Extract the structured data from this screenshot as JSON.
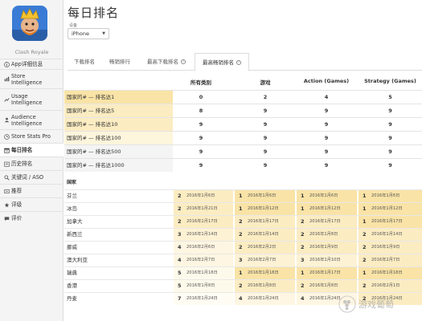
{
  "app": {
    "name": "Clash Royale"
  },
  "sidebar": {
    "items": [
      {
        "label": "App详细信息",
        "icon": "info-icon",
        "active": false
      },
      {
        "label": "Store\nIntelligence",
        "icon": "store-icon",
        "active": false
      },
      {
        "label": "Usage\nIntelligence",
        "icon": "usage-icon",
        "active": false
      },
      {
        "label": "Audience\nIntelligence",
        "icon": "audience-icon",
        "active": false
      },
      {
        "label": "Store Stats Pro",
        "icon": "stats-pro-icon",
        "active": false
      },
      {
        "label": "每日排名",
        "icon": "daily-rank-icon",
        "active": true
      },
      {
        "label": "历史排名",
        "icon": "history-rank-icon",
        "active": false
      },
      {
        "label": "关键词 / ASO",
        "icon": "keyword-icon",
        "active": false
      },
      {
        "label": "推荐",
        "icon": "recommend-icon",
        "active": false
      },
      {
        "label": "评级",
        "icon": "rating-icon",
        "active": false
      },
      {
        "label": "评价",
        "icon": "review-icon",
        "active": false
      }
    ]
  },
  "page": {
    "title": "每日排名"
  },
  "device": {
    "label": "设备",
    "value": "iPhone"
  },
  "tabs": [
    {
      "label": "下载排名",
      "help": false,
      "active": false
    },
    {
      "label": "畅销排行",
      "help": false,
      "active": false
    },
    {
      "label": "最高下载排名",
      "help": true,
      "active": false
    },
    {
      "label": "最高畅销排名",
      "help": true,
      "active": true
    }
  ],
  "summary": {
    "columns": [
      "所有类别",
      "游戏",
      "Action (Games)",
      "Strategy (Games)"
    ],
    "rows": [
      {
        "label": "国家的# — 排名达1",
        "values": [
          "0",
          "2",
          "4",
          "5"
        ]
      },
      {
        "label": "国家的# — 排名达5",
        "values": [
          "8",
          "9",
          "9",
          "9"
        ]
      },
      {
        "label": "国家的# — 排名达10",
        "values": [
          "9",
          "9",
          "9",
          "9"
        ]
      },
      {
        "label": "国家的# — 排名达100",
        "values": [
          "9",
          "9",
          "9",
          "9"
        ]
      },
      {
        "label": "国家的# — 排名达500",
        "values": [
          "9",
          "9",
          "9",
          "9"
        ]
      },
      {
        "label": "国家的# — 排名达1000",
        "values": [
          "9",
          "9",
          "9",
          "9"
        ]
      }
    ]
  },
  "countries": {
    "header": "国家",
    "rows": [
      {
        "name": "芬兰",
        "cells": [
          {
            "rank": "2",
            "date": "2016年1月6日"
          },
          {
            "rank": "1",
            "date": "2016年1月6日"
          },
          {
            "rank": "1",
            "date": "2016年1月6日"
          },
          {
            "rank": "1",
            "date": "2016年1月6日"
          }
        ]
      },
      {
        "name": "冰岛",
        "cells": [
          {
            "rank": "2",
            "date": "2016年1月21日"
          },
          {
            "rank": "1",
            "date": "2016年1月12日"
          },
          {
            "rank": "1",
            "date": "2016年1月12日"
          },
          {
            "rank": "1",
            "date": "2016年1月12日"
          }
        ]
      },
      {
        "name": "加拿大",
        "cells": [
          {
            "rank": "2",
            "date": "2016年1月17日"
          },
          {
            "rank": "2",
            "date": "2016年1月17日"
          },
          {
            "rank": "2",
            "date": "2016年1月17日"
          },
          {
            "rank": "1",
            "date": "2016年1月17日"
          }
        ]
      },
      {
        "name": "新西兰",
        "cells": [
          {
            "rank": "3",
            "date": "2016年1月14日"
          },
          {
            "rank": "2",
            "date": "2016年1月14日"
          },
          {
            "rank": "2",
            "date": "2016年1月8日"
          },
          {
            "rank": "2",
            "date": "2016年1月14日"
          }
        ]
      },
      {
        "name": "挪威",
        "cells": [
          {
            "rank": "4",
            "date": "2016年2月6日"
          },
          {
            "rank": "2",
            "date": "2016年2月2日"
          },
          {
            "rank": "2",
            "date": "2016年1月9日"
          },
          {
            "rank": "2",
            "date": "2016年1月9日"
          }
        ]
      },
      {
        "name": "澳大利亚",
        "cells": [
          {
            "rank": "4",
            "date": "2016年2月7日"
          },
          {
            "rank": "3",
            "date": "2016年2月7日"
          },
          {
            "rank": "3",
            "date": "2016年1月10日"
          },
          {
            "rank": "2",
            "date": "2016年2月7日"
          }
        ]
      },
      {
        "name": "瑞典",
        "cells": [
          {
            "rank": "5",
            "date": "2016年1月18日"
          },
          {
            "rank": "1",
            "date": "2016年1月18日"
          },
          {
            "rank": "1",
            "date": "2016年1月17日"
          },
          {
            "rank": "1",
            "date": "2016年1月18日"
          }
        ]
      },
      {
        "name": "香港",
        "cells": [
          {
            "rank": "5",
            "date": "2016年1月8日"
          },
          {
            "rank": "2",
            "date": "2016年1月8日"
          },
          {
            "rank": "2",
            "date": "2016年1月8日"
          },
          {
            "rank": "2",
            "date": "2016年2月1日"
          }
        ]
      },
      {
        "name": "丹麦",
        "cells": [
          {
            "rank": "7",
            "date": "2016年1月24日"
          },
          {
            "rank": "4",
            "date": "2016年1月24日"
          },
          {
            "rank": "4",
            "date": "2016年1月24日"
          },
          {
            "rank": "2",
            "date": "2016年1月24日"
          }
        ]
      }
    ]
  },
  "watermark": {
    "text": "游戏葡萄"
  },
  "colors": {
    "highlight_strong": "#f9e3a6",
    "highlight_mid": "#fbecc2",
    "highlight_light": "#fdf5dc",
    "highlight_pale": "#fefaeb",
    "sidebar_bg": "#f4f4f4"
  }
}
